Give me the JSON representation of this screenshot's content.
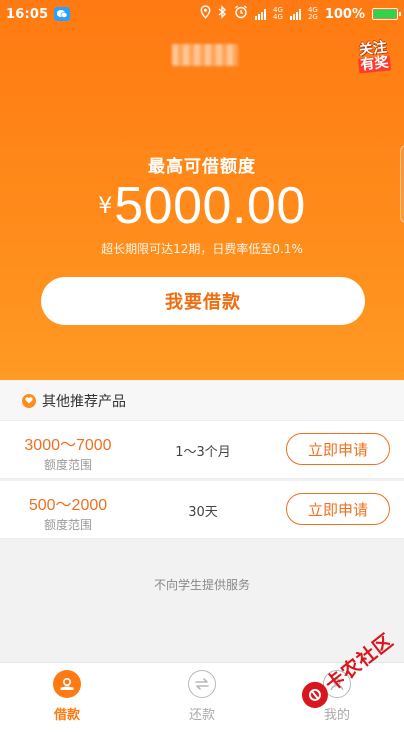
{
  "status_bar": {
    "time": "16:05",
    "network_top": "4G",
    "network_bottom": "4G",
    "network_bottom2": "2G",
    "battery": "100%"
  },
  "promo_badge": {
    "line1": "关注",
    "line2": "有奖"
  },
  "hero": {
    "limit_label": "最高可借额度",
    "currency": "¥",
    "amount": "5000.00",
    "subtitle": "超长期限可达12期，日费率低至0.1%",
    "borrow_button": "我要借款"
  },
  "recommended": {
    "title": "其他推荐产品",
    "products": [
      {
        "range": "3000～7000",
        "range_label": "额度范围",
        "term": "1～3个月",
        "apply": "立即申请"
      },
      {
        "range": "500～2000",
        "range_label": "额度范围",
        "term": "30天",
        "apply": "立即申请"
      }
    ]
  },
  "notice": "不向学生提供服务",
  "bottom_nav": {
    "items": [
      {
        "label": "借款",
        "icon": "borrow-icon",
        "active": true
      },
      {
        "label": "还款",
        "icon": "repay-icon",
        "active": false
      },
      {
        "label": "我的",
        "icon": "profile-icon",
        "active": false
      }
    ]
  },
  "watermark": {
    "text": "卡农社区"
  },
  "colors": {
    "accent": "#ff7a12",
    "accent_text": "#f07020",
    "battery": "#32d24a"
  }
}
